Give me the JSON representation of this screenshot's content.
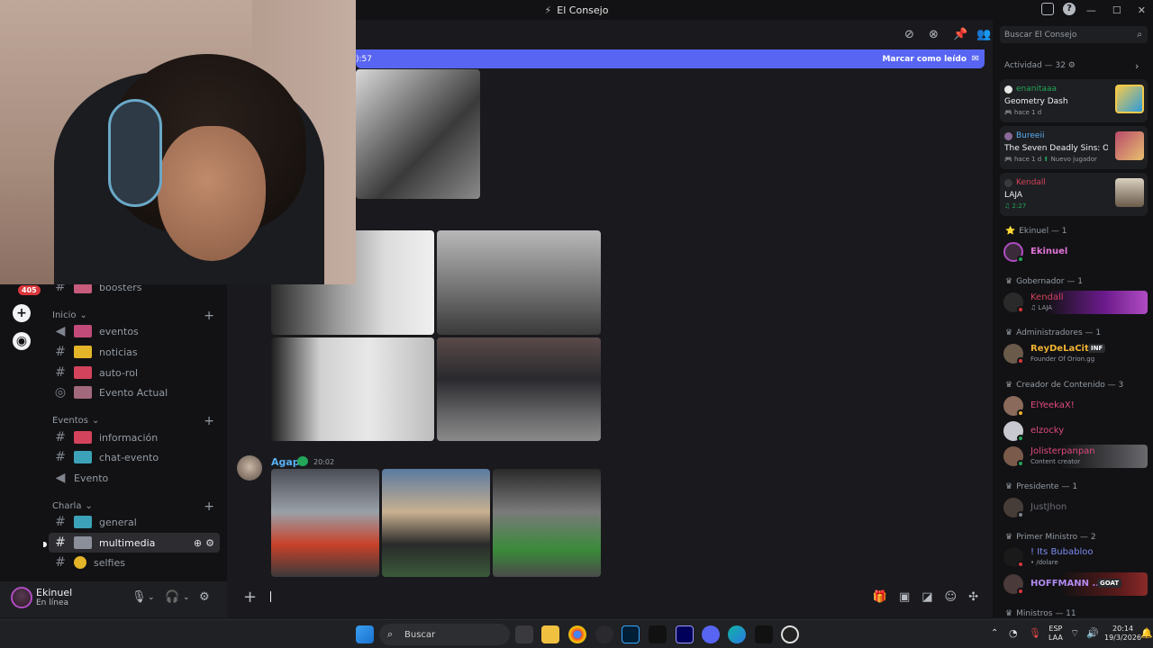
{
  "window": {
    "title": "El Consejo"
  },
  "rail": {
    "badge": "405"
  },
  "sidebar": {
    "pre": [
      {
        "label": "boosters",
        "color": "#c65b7c"
      }
    ],
    "categories": [
      {
        "name": "Inicio",
        "channels": [
          {
            "label": "eventos",
            "icon": "megaphone-icon",
            "color": "#c24b79"
          },
          {
            "label": "noticias",
            "icon": "hash-icon",
            "color": "#e4b429"
          },
          {
            "label": "auto-rol",
            "icon": "hash-icon",
            "color": "#d3435c"
          },
          {
            "label": "Evento Actual",
            "icon": "stage-icon",
            "color": "#a2697c"
          }
        ]
      },
      {
        "name": "Eventos",
        "channels": [
          {
            "label": "información",
            "icon": "hash-icon",
            "color": "#d3435c"
          },
          {
            "label": "chat-evento",
            "icon": "hash-icon",
            "color": "#3ca2b9"
          },
          {
            "label": "Evento",
            "icon": "speaker-icon",
            "color": ""
          }
        ]
      },
      {
        "name": "Charla",
        "channels": [
          {
            "label": "general",
            "icon": "hash-icon",
            "color": "#3ca2b9"
          },
          {
            "label": "multimedia",
            "icon": "hash-icon",
            "color": "#8a8f9a",
            "active": true
          },
          {
            "label": "selfies",
            "icon": "hash-icon",
            "color": "#e4b429"
          }
        ]
      }
    ]
  },
  "user": {
    "name": "Ekinuel",
    "status": "En línea"
  },
  "chat": {
    "banner_left": "):57",
    "banner_right": "Marcar como leído",
    "message": {
      "author": "Agapi",
      "time": "20:02"
    }
  },
  "rpanel": {
    "search_placeholder": "Buscar El Consejo",
    "activity_header": "Actividad — 32",
    "cards": [
      {
        "user": "enanitaaa",
        "user_color": "#23a55a",
        "game": "Geometry Dash",
        "sub": "hace 1 d",
        "extra": ""
      },
      {
        "user": "Bureeii",
        "user_color": "#5ab0f2",
        "game": "The Seven Deadly Sins: Ori...",
        "sub": "hace 1 d",
        "extra": "Nuevo jugador"
      },
      {
        "user": "Kendall",
        "user_color": "#d3435c",
        "game": "LAJA",
        "sub": "2:27",
        "extra": ""
      }
    ],
    "groups": [
      {
        "role": "Ekinuel — 1",
        "members": [
          {
            "name": "Ekinuel",
            "color": "#e073d6",
            "sub": ""
          }
        ]
      },
      {
        "role": "Gobernador — 1",
        "members": [
          {
            "name": "Kendall",
            "color": "#d3435c",
            "sub": "LAJA"
          }
        ]
      },
      {
        "role": "Administradores — 1",
        "members": [
          {
            "name": "ReyDeLaCity",
            "color": "#f0b232",
            "sub": "Founder Of Orion.gg",
            "tag": "INF"
          }
        ]
      },
      {
        "role": "Creador de Contenido — 3",
        "members": [
          {
            "name": "ElYeekaX!",
            "color": "#e04a7e",
            "sub": ""
          },
          {
            "name": "elzocky",
            "color": "#e04a7e",
            "sub": ""
          },
          {
            "name": "Jolisterpanpan",
            "color": "#e04a7e",
            "sub": "Content creator"
          }
        ]
      },
      {
        "role": "Presidente — 1",
        "members": [
          {
            "name": "JustJhon",
            "color": "#6d6f78",
            "sub": ""
          }
        ]
      },
      {
        "role": "Primer Ministro — 2",
        "members": [
          {
            "name": "! Its Bubabloo",
            "color": "#7b8cf0",
            "sub": "• /dolare"
          },
          {
            "name": "HOFFMANN ...",
            "color": "#b28af0",
            "sub": "",
            "tag": "GOAT"
          }
        ]
      },
      {
        "role": "Ministros — 11",
        "members": []
      }
    ]
  },
  "taskbar": {
    "search": "Buscar",
    "lang_top": "ESP",
    "lang_bottom": "LAA",
    "time": "20:14",
    "date": "19/3/2026"
  }
}
